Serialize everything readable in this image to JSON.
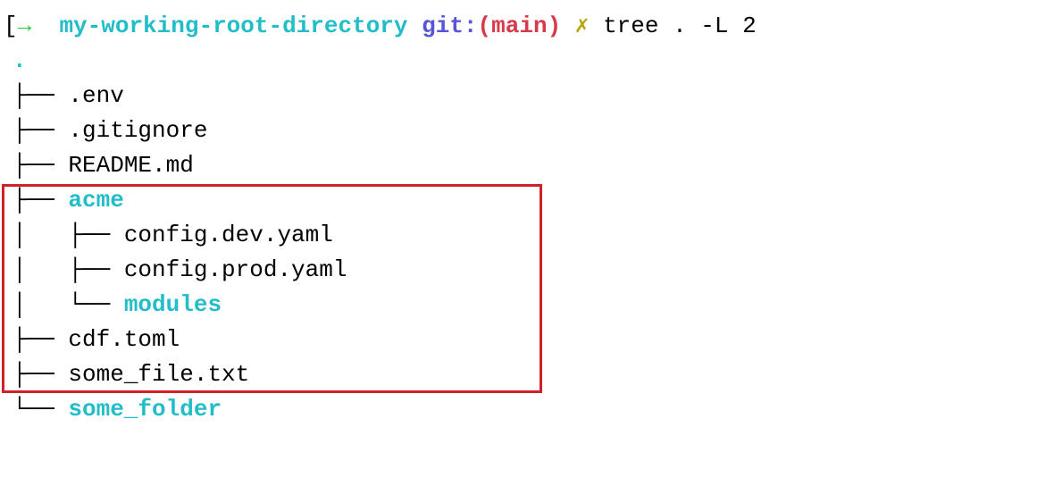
{
  "prompt": {
    "bracket": "[",
    "arrow": "→",
    "cwd": "my-working-root-directory",
    "git_label": "git:",
    "paren_open": "(",
    "branch": "main",
    "paren_close": ")",
    "dirty_marker": "✗",
    "command": "tree . -L 2"
  },
  "tree": {
    "root_line": ".",
    "lines": [
      {
        "prefix": "├── ",
        "name": ".env",
        "is_dir": false
      },
      {
        "prefix": "├── ",
        "name": ".gitignore",
        "is_dir": false
      },
      {
        "prefix": "├── ",
        "name": "README.md",
        "is_dir": false
      },
      {
        "prefix": "├── ",
        "name": "acme",
        "is_dir": true
      },
      {
        "prefix": "│   ├── ",
        "name": "config.dev.yaml",
        "is_dir": false
      },
      {
        "prefix": "│   ├── ",
        "name": "config.prod.yaml",
        "is_dir": false
      },
      {
        "prefix": "│   └── ",
        "name": "modules",
        "is_dir": true
      },
      {
        "prefix": "├── ",
        "name": "cdf.toml",
        "is_dir": false
      },
      {
        "prefix": "├── ",
        "name": "some_file.txt",
        "is_dir": false
      },
      {
        "prefix": "└── ",
        "name": "some_folder",
        "is_dir": true
      }
    ]
  }
}
